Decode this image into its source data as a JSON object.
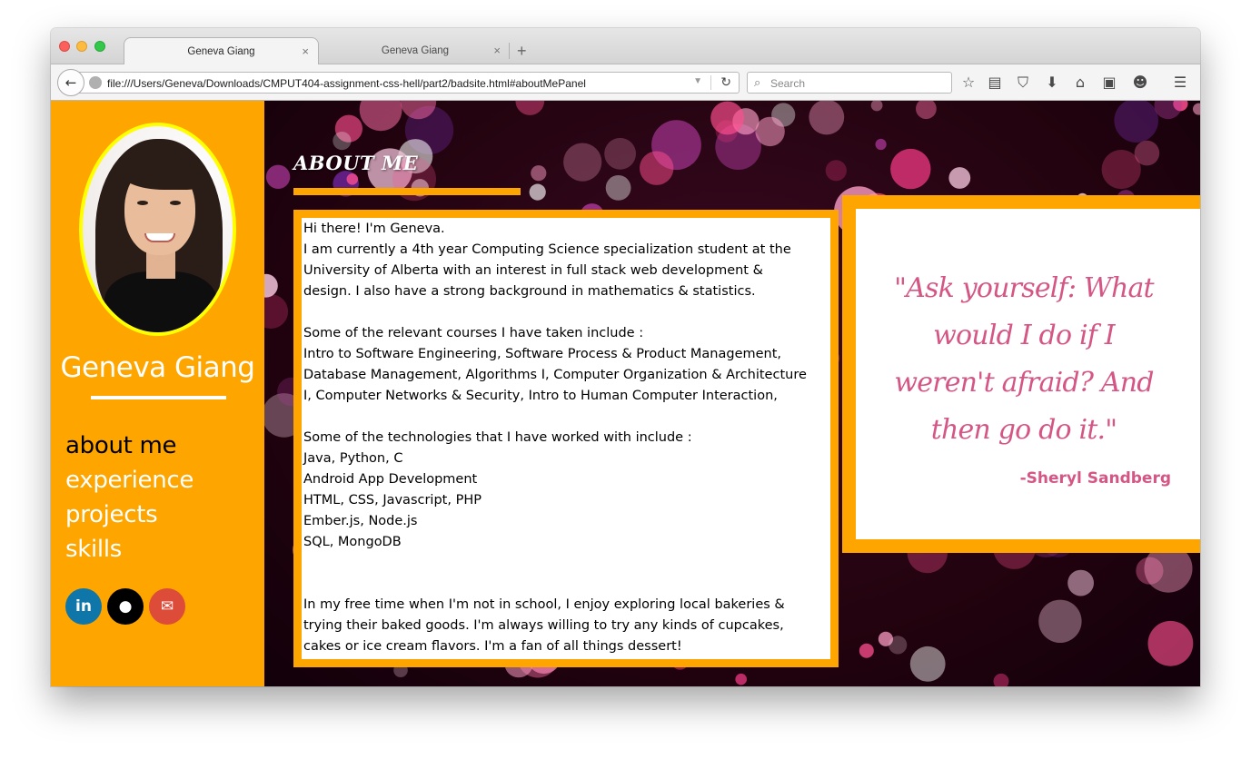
{
  "browser": {
    "tabs": [
      {
        "title": "Geneva Giang",
        "active": true
      },
      {
        "title": "Geneva Giang",
        "active": false
      }
    ],
    "tab_close_glyph": "×",
    "new_tab_glyph": "+",
    "url": "file:///Users/Geneva/Downloads/CMPUT404-assignment-css-hell/part2/badsite.html#aboutMePanel",
    "search_placeholder": "Search",
    "toolbar_icons": [
      "bookmark-star-icon",
      "reading-list-icon",
      "pocket-icon",
      "download-icon",
      "home-icon",
      "screenshot-icon",
      "emoji-icon",
      "menu-icon"
    ]
  },
  "profile": {
    "name": "Geneva Giang",
    "photo_alt": "Geneva Giang profile photo"
  },
  "nav": {
    "items": [
      "about me",
      "experience",
      "projects",
      "skills"
    ],
    "current": "about me"
  },
  "social": {
    "linkedin_glyph": "in",
    "github_glyph": "●",
    "email_glyph": "✉"
  },
  "about": {
    "heading": "ABOUT ME",
    "paragraphs": [
      [
        "Hi there! I'm Geneva.",
        "I am currently a 4th year Computing Science specialization student at the",
        "University of Alberta with an interest in full stack web development &",
        "design. I also have a strong background in mathematics & statistics."
      ],
      [
        "Some of the relevant courses I have taken include :",
        "Intro to Software Engineering, Software Process & Product Management,",
        "Database Management, Algorithms I, Computer Organization & Architecture",
        "I, Computer Networks & Security, Intro to Human Computer Interaction,"
      ],
      [
        "Some of the technologies that I have worked with include :",
        "Java, Python, C",
        "Android App Development",
        "HTML, CSS, Javascript, PHP",
        "Ember.js, Node.js",
        "SQL, MongoDB"
      ],
      [],
      [
        "In my free time when I'm not in school, I enjoy exploring local bakeries &",
        "trying their baked goods. I'm always willing to try any kinds of cupcakes,",
        "cakes or ice cream flavors. I'm a fan of all things dessert!"
      ]
    ]
  },
  "quote": {
    "text": "\"Ask yourself: What would I do if I weren't afraid? And then go do it.\"",
    "author": "-Sheryl Sandberg"
  },
  "colors": {
    "sidebar": "#fea500",
    "photo_border": "#ffff00",
    "quote_text": "#d55685",
    "linkedin": "#0e76a8",
    "github": "#000000",
    "email": "#dd4b39"
  }
}
